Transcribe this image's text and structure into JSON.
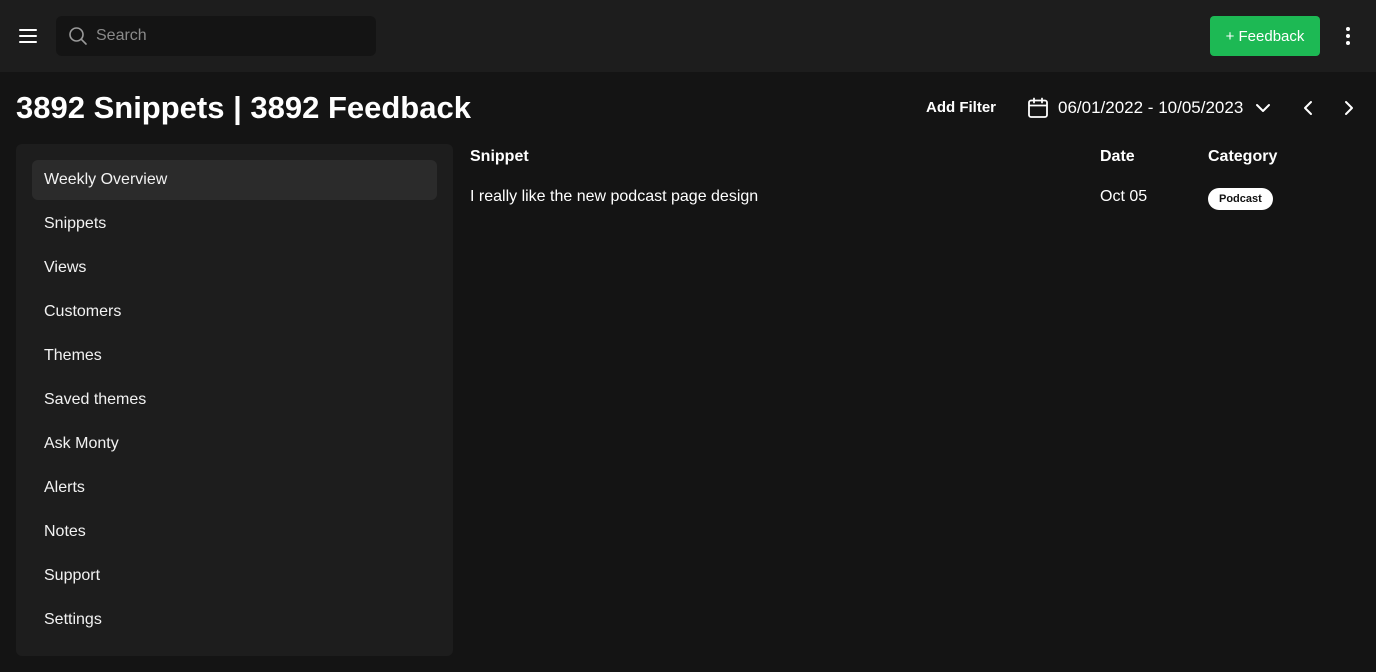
{
  "topbar": {
    "search_placeholder": "Search",
    "feedback_button": "+ Feedback",
    "accent_color": "#1db954"
  },
  "header": {
    "title": "3892 Snippets | 3892 Feedback",
    "add_filter": "Add Filter",
    "date_range": "06/01/2022 - 10/05/2023"
  },
  "sidebar": {
    "items": [
      {
        "label": "Weekly Overview",
        "active": true
      },
      {
        "label": "Snippets"
      },
      {
        "label": "Views"
      },
      {
        "label": "Customers"
      },
      {
        "label": "Themes"
      },
      {
        "label": "Saved themes"
      },
      {
        "label": "Ask Monty"
      },
      {
        "label": "Alerts"
      },
      {
        "label": "Notes"
      },
      {
        "label": "Support"
      },
      {
        "label": "Settings"
      }
    ]
  },
  "table": {
    "columns": [
      "Snippet",
      "Date",
      "Category"
    ],
    "rows": [
      {
        "snippet": "I really like the new podcast page design",
        "date": "Oct 05",
        "category": "Podcast"
      }
    ]
  },
  "icons": [
    "menu-icon",
    "search-icon",
    "more-vertical-icon",
    "calendar-icon",
    "chevron-down-icon",
    "chevron-left-icon",
    "chevron-right-icon"
  ]
}
